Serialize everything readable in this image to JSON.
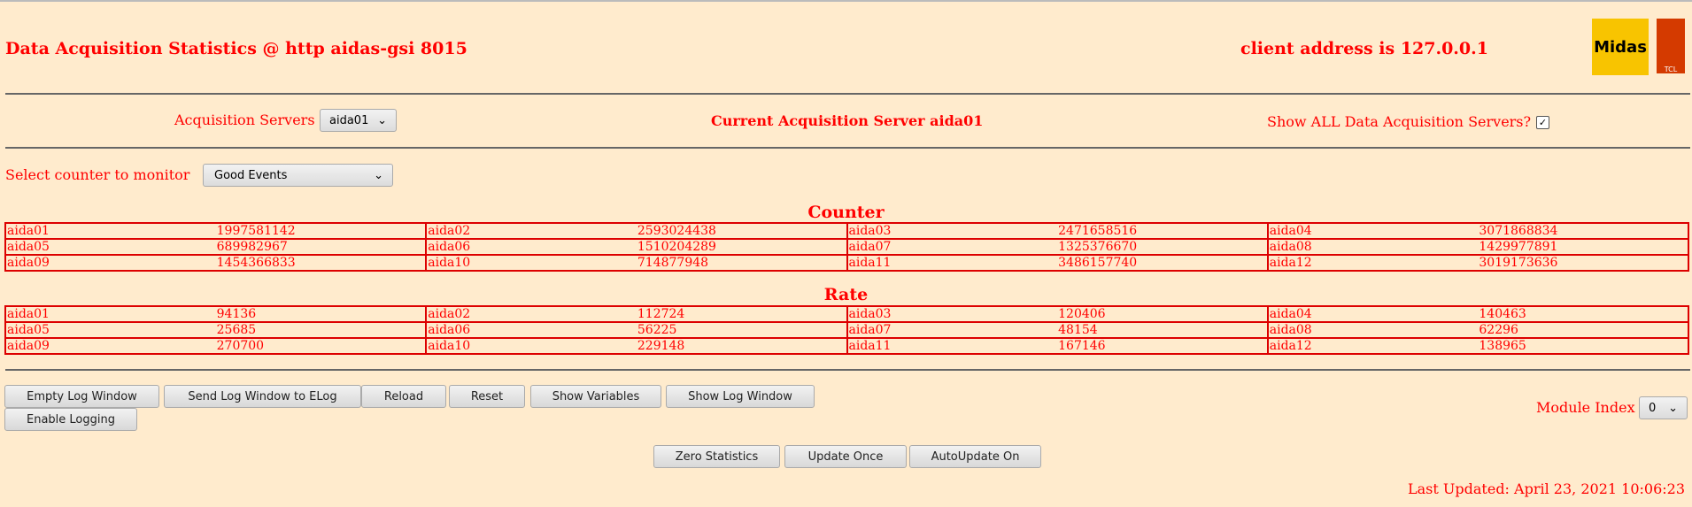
{
  "header": {
    "title": "Data Acquisition Statistics @ http aidas-gsi 8015",
    "client": "client address is 127.0.0.1",
    "logo_midas": "Midas",
    "logo_tcl": "TCL POWERED"
  },
  "servers": {
    "label": "Acquisition Servers",
    "selected": "aida01",
    "current": "Current Acquisition Server aida01",
    "show_all_label": "Show ALL Data Acquisition Servers?",
    "show_all_checked": true
  },
  "counter_select": {
    "label": "Select counter to monitor",
    "selected": "Good Events"
  },
  "counter": {
    "title": "Counter",
    "rows": [
      [
        [
          "aida01",
          "1997581142"
        ],
        [
          "aida02",
          "2593024438"
        ],
        [
          "aida03",
          "2471658516"
        ],
        [
          "aida04",
          "3071868834"
        ]
      ],
      [
        [
          "aida05",
          "689982967"
        ],
        [
          "aida06",
          "1510204289"
        ],
        [
          "aida07",
          "1325376670"
        ],
        [
          "aida08",
          "1429977891"
        ]
      ],
      [
        [
          "aida09",
          "1454366833"
        ],
        [
          "aida10",
          "714877948"
        ],
        [
          "aida11",
          "3486157740"
        ],
        [
          "aida12",
          "3019173636"
        ]
      ]
    ]
  },
  "rate": {
    "title": "Rate",
    "rows": [
      [
        [
          "aida01",
          "94136"
        ],
        [
          "aida02",
          "112724"
        ],
        [
          "aida03",
          "120406"
        ],
        [
          "aida04",
          "140463"
        ]
      ],
      [
        [
          "aida05",
          "25685"
        ],
        [
          "aida06",
          "56225"
        ],
        [
          "aida07",
          "48154"
        ],
        [
          "aida08",
          "62296"
        ]
      ],
      [
        [
          "aida09",
          "270700"
        ],
        [
          "aida10",
          "229148"
        ],
        [
          "aida11",
          "167146"
        ],
        [
          "aida12",
          "138965"
        ]
      ]
    ]
  },
  "buttons": {
    "empty_log": "Empty Log Window",
    "send_log": "Send Log Window to ELog",
    "reload": "Reload",
    "reset": "Reset",
    "show_vars": "Show Variables",
    "show_log": "Show Log Window",
    "enable_logging": "Enable Logging",
    "zero_stats": "Zero Statistics",
    "update_once": "Update Once",
    "autoupdate": "AutoUpdate On"
  },
  "module": {
    "label": "Module Index",
    "selected": "0"
  },
  "footer": {
    "last_updated": "Last Updated: April 23, 2021 10:06:23"
  }
}
